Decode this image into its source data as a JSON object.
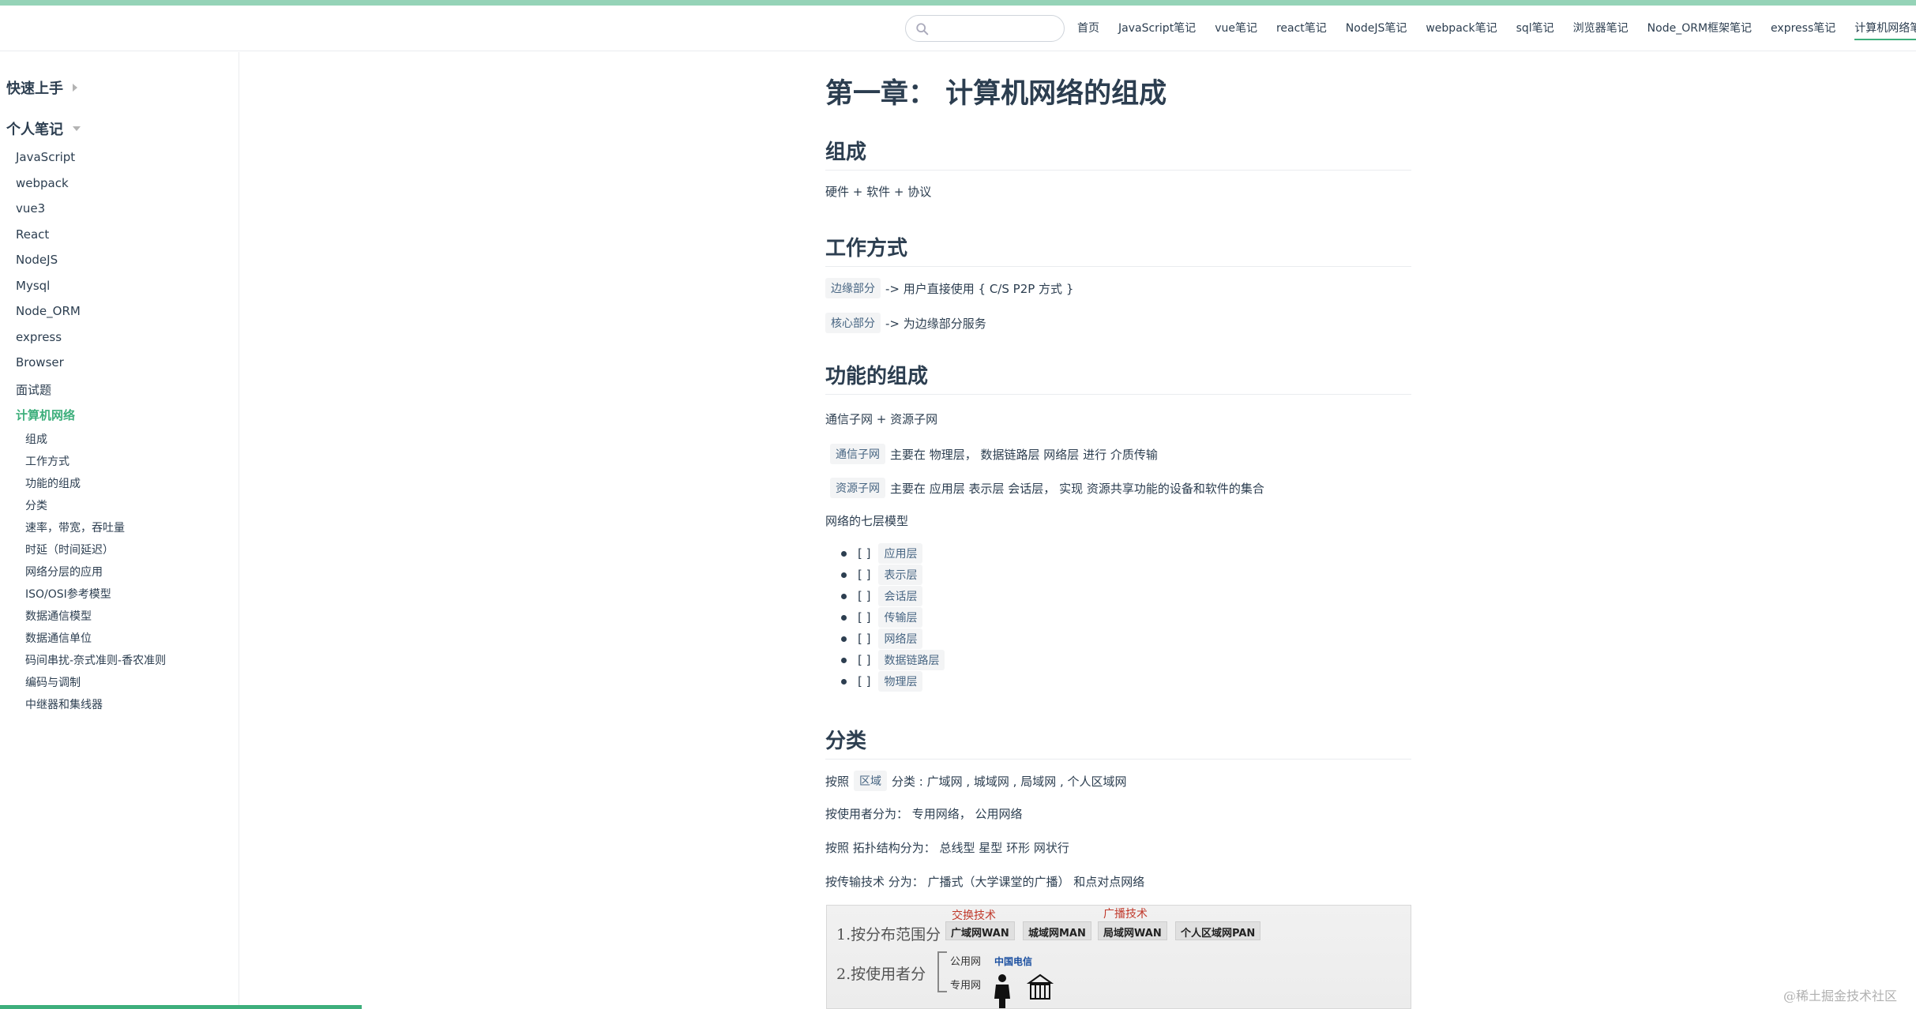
{
  "search": {
    "placeholder": ""
  },
  "nav": [
    "首页",
    "JavaScript笔记",
    "vue笔记",
    "react笔记",
    "NodeJS笔记",
    "webpack笔记",
    "sql笔记",
    "浏览器笔记",
    "Node_ORM框架笔记",
    "express笔记",
    "计算机网络笔记"
  ],
  "sidebar": {
    "group1": "快速上手",
    "group2": "个人笔记",
    "items": [
      "JavaScript",
      "webpack",
      "vue3",
      "React",
      "NodeJS",
      "Mysql",
      "Node_ORM",
      "express",
      "Browser",
      "面试题",
      "计算机网络"
    ],
    "subitems": [
      "组成",
      "工作方式",
      "功能的组成",
      "分类",
      "速率，带宽，吞吐量",
      "时延（时间延迟）",
      "网络分层的应用",
      "ISO/OSI参考模型",
      "数据通信模型",
      "数据通信单位",
      "码间串扰-奈式准则-香农准则",
      "编码与调制",
      "中继器和集线器"
    ]
  },
  "content": {
    "title": "第一章： 计算机网络的组成",
    "h_zucheng": "组成",
    "p_zucheng": "硬件 + 软件 + 协议",
    "h_gongzuo": "工作方式",
    "code_bianyuan": "边缘部分",
    "p_bianyuan": "-> 用户直接使用 { C/S P2P 方式 }",
    "code_hexin": "核心部分",
    "p_hexin": "-> 为边缘部分服务",
    "h_gongneng": "功能的组成",
    "p_tongxin_ziyuan": "通信子网 + 资源子网",
    "code_tongxin": "通信子网",
    "p_tongxin": "主要在 物理层， 数据链路层 网络层 进行 介质传输",
    "code_ziyuan": "资源子网",
    "p_ziyuan": "主要在 应用层 表示层 会话层， 实现 资源共享功能的设备和软件的集合",
    "p_qiceng": "网络的七层模型",
    "layer_check": "[ ]",
    "layers": [
      "应用层",
      "表示层",
      "会话层",
      "传输层",
      "网络层",
      "数据链路层",
      "物理层"
    ],
    "h_fenlei": "分类",
    "p_quyu_pre": "按照",
    "code_quyu": "区域",
    "p_quyu_post": "分类 : 广域网 , 城域网 , 局域网 , 个人区域网",
    "p_shiyongzhe": "按使用者分为：  专用网络， 公用网络",
    "p_tuopu": "按照 拓扑结构分为：  总线型 星型 环形 网状行",
    "p_chuanshu": "按传输技术 分为：  广播式（大学课堂的广播） 和点对点网络"
  },
  "figure": {
    "row1": "1.按分布范围分",
    "row2": "2.按使用者分",
    "red1": "交换技术",
    "red2": "广播技术",
    "boxes": [
      "广域网WAN",
      "城域网MAN",
      "局域网WAN",
      "个人区域网PAN"
    ],
    "public": "公用网",
    "private": "专用网",
    "logo": "中国电信"
  },
  "watermark": "@稀土掘金技术社区",
  "colors": {
    "accent": "#3eaf7c",
    "text": "#2c3e50",
    "code_bg": "#f3f4f5",
    "code_text": "#476582"
  }
}
